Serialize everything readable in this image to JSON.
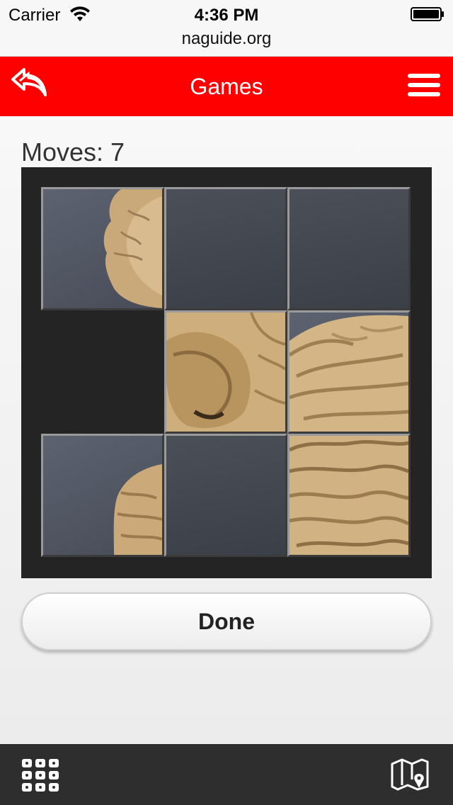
{
  "status_bar": {
    "carrier": "Carrier",
    "time": "4:36 PM",
    "wifi_icon": "wifi-icon",
    "battery_icon": "battery-icon"
  },
  "url_bar": {
    "url": "naguide.org"
  },
  "header": {
    "title": "Games",
    "back_icon": "reply-arrow-icon",
    "menu_icon": "hamburger-menu-icon",
    "background_color": "#ff0000"
  },
  "game": {
    "moves_label": "Moves: 7",
    "board_color": "#242424",
    "grid_size": 3,
    "tiles_description": [
      {
        "row": 0,
        "col": 0,
        "content": "lion-sculpture-left-head",
        "empty": false
      },
      {
        "row": 0,
        "col": 1,
        "content": "plain-gray-background",
        "empty": false
      },
      {
        "row": 0,
        "col": 2,
        "content": "plain-gray-background",
        "empty": false
      },
      {
        "row": 1,
        "col": 0,
        "content": "",
        "empty": true
      },
      {
        "row": 1,
        "col": 1,
        "content": "lion-sculpture-face",
        "empty": false
      },
      {
        "row": 1,
        "col": 2,
        "content": "lion-sculpture-mane-right",
        "empty": false
      },
      {
        "row": 2,
        "col": 0,
        "content": "lion-sculpture-lower-left",
        "empty": false
      },
      {
        "row": 2,
        "col": 1,
        "content": "plain-gray-background",
        "empty": false
      },
      {
        "row": 2,
        "col": 2,
        "content": "lion-sculpture-mane-lower",
        "empty": false
      }
    ]
  },
  "actions": {
    "done_label": "Done"
  },
  "bottom_bar": {
    "left_icon": "keypad-grid-icon",
    "right_icon": "map-location-icon",
    "background_color": "#2e2e2e"
  }
}
